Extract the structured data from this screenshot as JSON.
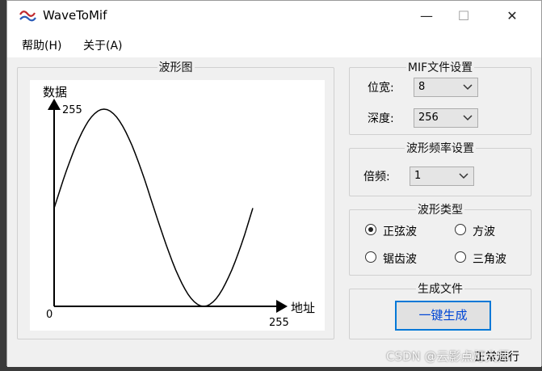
{
  "window": {
    "title": "WaveToMif",
    "controls": {
      "minimize": "—",
      "maximize": "☐",
      "close": "✕"
    }
  },
  "menu": {
    "items": [
      {
        "label": "帮助(H)"
      },
      {
        "label": "关于(A)"
      }
    ]
  },
  "waveform_panel": {
    "title": "波形图",
    "chart_data": {
      "type": "line",
      "ylabel": "数据",
      "xlabel": "地址",
      "x_ticks": [
        "0",
        "255"
      ],
      "y_ticks": [
        "0",
        "255"
      ],
      "xlim": [
        0,
        255
      ],
      "ylim": [
        0,
        255
      ],
      "series": [
        {
          "values": [
            {
              "x": 0,
              "y": 127
            },
            {
              "x": 16,
              "y": 176
            },
            {
              "x": 32,
              "y": 217
            },
            {
              "x": 48,
              "y": 245
            },
            {
              "x": 64,
              "y": 255
            },
            {
              "x": 80,
              "y": 245
            },
            {
              "x": 96,
              "y": 217
            },
            {
              "x": 112,
              "y": 176
            },
            {
              "x": 128,
              "y": 127
            },
            {
              "x": 144,
              "y": 79
            },
            {
              "x": 160,
              "y": 38
            },
            {
              "x": 176,
              "y": 10
            },
            {
              "x": 192,
              "y": 0
            },
            {
              "x": 208,
              "y": 10
            },
            {
              "x": 224,
              "y": 38
            },
            {
              "x": 240,
              "y": 79
            },
            {
              "x": 255,
              "y": 127
            }
          ]
        }
      ]
    }
  },
  "mif_settings": {
    "title": "MIF文件设置",
    "width_label": "位宽:",
    "width_value": "8",
    "depth_label": "深度:",
    "depth_value": "256"
  },
  "freq_settings": {
    "title": "波形频率设置",
    "mult_label": "倍频:",
    "mult_value": "1"
  },
  "wave_type": {
    "title": "波形类型",
    "options": [
      {
        "label": "正弦波",
        "selected": true
      },
      {
        "label": "方波",
        "selected": false
      },
      {
        "label": "锯齿波",
        "selected": false
      },
      {
        "label": "三角波",
        "selected": false
      }
    ]
  },
  "generate": {
    "title": "生成文件",
    "button": "一键生成"
  },
  "status": {
    "text": "正常运行"
  },
  "watermark": "CSDN @云影点灯大师"
}
